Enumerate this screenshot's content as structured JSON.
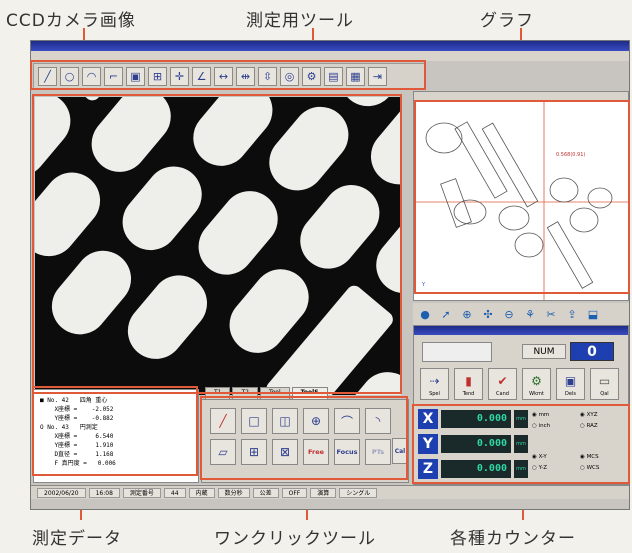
{
  "callouts": {
    "camera": "CCDカメラ画像",
    "tools": "測定用ツール",
    "graph": "グラフ",
    "data": "測定データ",
    "oneclick": "ワンクリックツール",
    "counters": "各種カウンター"
  },
  "num_panel": {
    "label": "NUM",
    "value": "0"
  },
  "action_buttons": [
    "Spel",
    "Tend",
    "Cand",
    "Wkmt",
    "Dels",
    "Qal"
  ],
  "counters": [
    {
      "axis": "X",
      "value": "0.000",
      "unit": "mm"
    },
    {
      "axis": "Y",
      "value": "0.000",
      "unit": "mm"
    },
    {
      "axis": "Z",
      "value": "0.000",
      "unit": "mm"
    }
  ],
  "counter_options": {
    "unit": [
      "mm",
      "inch"
    ],
    "plane": [
      "X-Y",
      "Y-Z"
    ],
    "right_top": [
      "XYZ",
      "RAZ"
    ],
    "right_bottom": [
      "MCS",
      "WCS"
    ]
  },
  "data_lines": [
    "■ No. 42   四角 重心",
    "    X座標 =    -2.052",
    "    Y座標 =    -0.882",
    "O No. 43   円測定",
    "    X座標 =     6.540",
    "    Y座標 =     1.910",
    "    D直径 =     1.168",
    "    F 真円度 =   0.006"
  ],
  "tabs": [
    "T1",
    "T2",
    "Tool",
    "ToolS"
  ],
  "oneclick_text": [
    "Free",
    "Focus",
    "PTs",
    "Cal"
  ],
  "graph_annotation": "0.568(0.91)",
  "status": [
    "2002/06/20",
    "16:08",
    "測定番号",
    "44",
    "内蔵",
    "数分秒",
    "公差",
    "OFF",
    "演算",
    "シングル"
  ]
}
